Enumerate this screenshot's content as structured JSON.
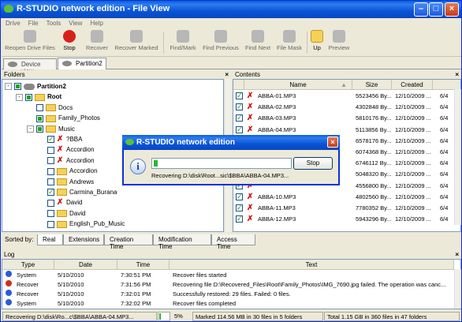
{
  "window": {
    "title": "R-STUDIO network edition - File View",
    "accent": "#0a54d4"
  },
  "menu": [
    "Drive",
    "File",
    "Tools",
    "View",
    "Help"
  ],
  "toolbar": {
    "items": [
      {
        "label": "Reopen Drive Files",
        "icon": "reopen-icon",
        "enabled": false
      },
      {
        "label": "Stop",
        "icon": "stop-icon",
        "enabled": true
      },
      {
        "label": "Recover",
        "icon": "recover-icon",
        "enabled": false
      },
      {
        "label": "Recover Marked",
        "icon": "recover-marked-icon",
        "enabled": false
      },
      {
        "label": "Find/Mark",
        "icon": "binoculars-icon",
        "enabled": false
      },
      {
        "label": "Find Previous",
        "icon": "find-previous-icon",
        "enabled": false
      },
      {
        "label": "Find Next",
        "icon": "find-next-icon",
        "enabled": false
      },
      {
        "label": "File Mask",
        "icon": "file-mask-icon",
        "enabled": false
      },
      {
        "label": "Up",
        "icon": "folder-up-icon",
        "enabled": true
      },
      {
        "label": "Preview",
        "icon": "preview-icon",
        "enabled": false
      }
    ]
  },
  "tabs": [
    {
      "label": "Device view",
      "icon": "device-icon"
    },
    {
      "label": "Partition2",
      "icon": "disk-icon",
      "active": true
    }
  ],
  "folders": {
    "title": "Folders",
    "tree": [
      {
        "label": "Partition2",
        "level": 0,
        "toggle": "-",
        "check": "part",
        "icon": "drive",
        "bold": true
      },
      {
        "label": "Root",
        "level": 1,
        "toggle": "-",
        "check": "part",
        "icon": "folder",
        "bold": true
      },
      {
        "label": "Docs",
        "level": 2,
        "toggle": "",
        "check": "none",
        "icon": "folder"
      },
      {
        "label": "Family_Photos",
        "level": 2,
        "toggle": "",
        "check": "part",
        "icon": "folder"
      },
      {
        "label": "Music",
        "level": 2,
        "toggle": "-",
        "check": "part",
        "icon": "folder"
      },
      {
        "label": "?BBA",
        "level": 3,
        "toggle": "",
        "check": "full",
        "icon": "xfile"
      },
      {
        "label": "Accordion",
        "level": 3,
        "toggle": "",
        "check": "none",
        "icon": "xfile"
      },
      {
        "label": "Accordion",
        "level": 3,
        "toggle": "",
        "check": "none",
        "icon": "xfile"
      },
      {
        "label": "Accordion",
        "level": 3,
        "toggle": "",
        "check": "none",
        "icon": "folder"
      },
      {
        "label": "Andrews",
        "level": 3,
        "toggle": "",
        "check": "none",
        "icon": "folder"
      },
      {
        "label": "Carmina_Burana",
        "level": 3,
        "toggle": "",
        "check": "full",
        "icon": "folder"
      },
      {
        "label": "David",
        "level": 3,
        "toggle": "",
        "check": "none",
        "icon": "xfile"
      },
      {
        "label": "David",
        "level": 3,
        "toggle": "",
        "check": "none",
        "icon": "folder"
      },
      {
        "label": "English_Pub_Music",
        "level": 3,
        "toggle": "",
        "check": "none",
        "icon": "folder"
      }
    ]
  },
  "sort": {
    "label": "Sorted by:",
    "tabs": [
      "Real",
      "Extensions",
      "Creation Time",
      "Modification Time",
      "Access Time"
    ]
  },
  "contents": {
    "title": "Contents",
    "columns": [
      "Name",
      "Size",
      "Created"
    ],
    "rows": [
      {
        "name": "ABBA-01.MP3",
        "size": "5523456 By...",
        "created": "12/10/2009 ...",
        "mod": "6/4"
      },
      {
        "name": "ABBA-02.MP3",
        "size": "4302848 By...",
        "created": "12/10/2009 ...",
        "mod": "6/4"
      },
      {
        "name": "ABBA-03.MP3",
        "size": "5810176 By...",
        "created": "12/10/2009 ...",
        "mod": "6/4"
      },
      {
        "name": "ABBA-04.MP3",
        "size": "5113856 By...",
        "created": "12/10/2009 ...",
        "mod": "6/4"
      },
      {
        "name": "",
        "size": "6578176 By...",
        "created": "12/10/2009 ...",
        "mod": "6/4"
      },
      {
        "name": "",
        "size": "6074368 By...",
        "created": "12/10/2009 ...",
        "mod": "6/4"
      },
      {
        "name": "",
        "size": "6746112 By...",
        "created": "12/10/2009 ...",
        "mod": "6/4"
      },
      {
        "name": "",
        "size": "5048320 By...",
        "created": "12/10/2009 ...",
        "mod": "6/4"
      },
      {
        "name": "",
        "size": "4556800 By...",
        "created": "12/10/2009 ...",
        "mod": "6/4"
      },
      {
        "name": "ABBA-10.MP3",
        "size": "4802560 By...",
        "created": "12/10/2009 ...",
        "mod": "6/4"
      },
      {
        "name": "ABBA-11.MP3",
        "size": "7780352 By...",
        "created": "12/10/2009 ...",
        "mod": "6/4"
      },
      {
        "name": "ABBA-12.MP3",
        "size": "5943296 By...",
        "created": "12/10/2009 ...",
        "mod": "6/4"
      }
    ]
  },
  "log": {
    "title": "Log",
    "columns": [
      "Type",
      "Date",
      "Time",
      "Text"
    ],
    "rows": [
      {
        "type": "System",
        "date": "5/10/2010",
        "time": "7:30:51 PM",
        "text": "Recover files started",
        "color": "#2a5bd7"
      },
      {
        "type": "Recover",
        "date": "5/10/2010",
        "time": "7:31:56 PM",
        "text": "Recovering file D:\\Recovered_Files\\Root\\Family_Photos\\IMG_7690.jpg failed. The operation was canc...",
        "color": "#d0301a"
      },
      {
        "type": "Recover",
        "date": "5/10/2010",
        "time": "7:32:01 PM",
        "text": "Successfully restored: 29 files. Failed: 0 files.",
        "color": "#2a5bd7"
      },
      {
        "type": "System",
        "date": "5/10/2010",
        "time": "7:32:02 PM",
        "text": "Recover files completed",
        "color": "#2a5bd7"
      }
    ]
  },
  "status": {
    "path": "Recovering D:\\disk\\Ro...c\\$BBA\\ABBA-04.MP3...",
    "percent": "5%",
    "progress": 0.05,
    "marked": "Marked 114.56 MB in 30 files in 5 folders",
    "total": "Total 1.15 GB in 360 files in 47 folders"
  },
  "dialog": {
    "title": "R-STUDIO network edition",
    "stop": "Stop",
    "text": "Recovering D:\\disk\\Root...sic\\$BBA\\ABBA-04.MP3...",
    "progress": 0.03
  }
}
